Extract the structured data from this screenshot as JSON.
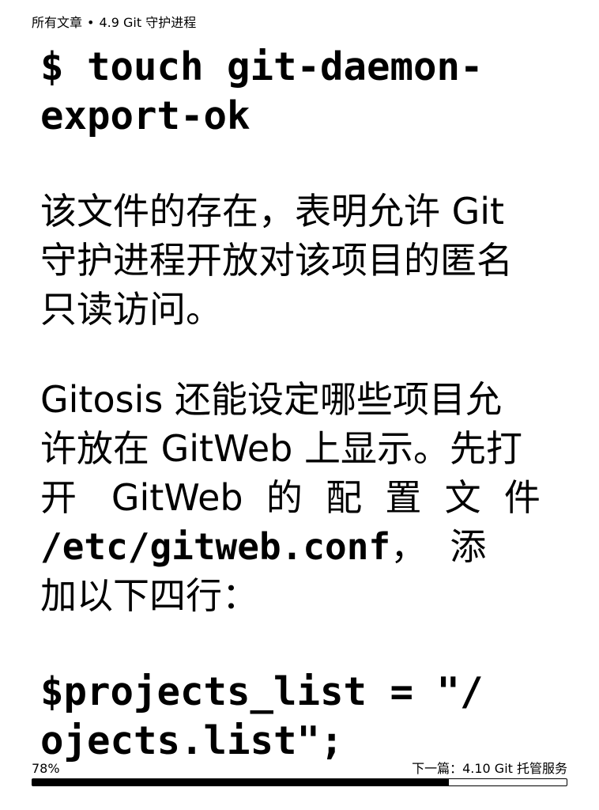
{
  "header": {
    "section": "所有文章",
    "separator": "•",
    "chapter": "4.9 Git 守护进程"
  },
  "content": {
    "code1": [
      "$ touch git-daemon-",
      "export-ok"
    ],
    "para1": [
      "该文件的存在，表明允许 Git",
      "守护进程开放对该项目的匿名",
      "只读访问。"
    ],
    "para2_lines": [
      "Gitosis 还能设定哪些项目允",
      "许放在 GitWeb 上显示。先打",
      "开   GitWeb  的  配  置  文  件"
    ],
    "para2_path": "/etc/gitweb.conf",
    "para2_path_suffix": "，  添",
    "para2_last": "加以下四行：",
    "code2": [
      "$projects_list = \"/",
      "ojects.list\";"
    ]
  },
  "footer": {
    "progress_label": "78%",
    "progress_value": 0.78,
    "next": "下一篇：4.10 Git 托管服务"
  }
}
